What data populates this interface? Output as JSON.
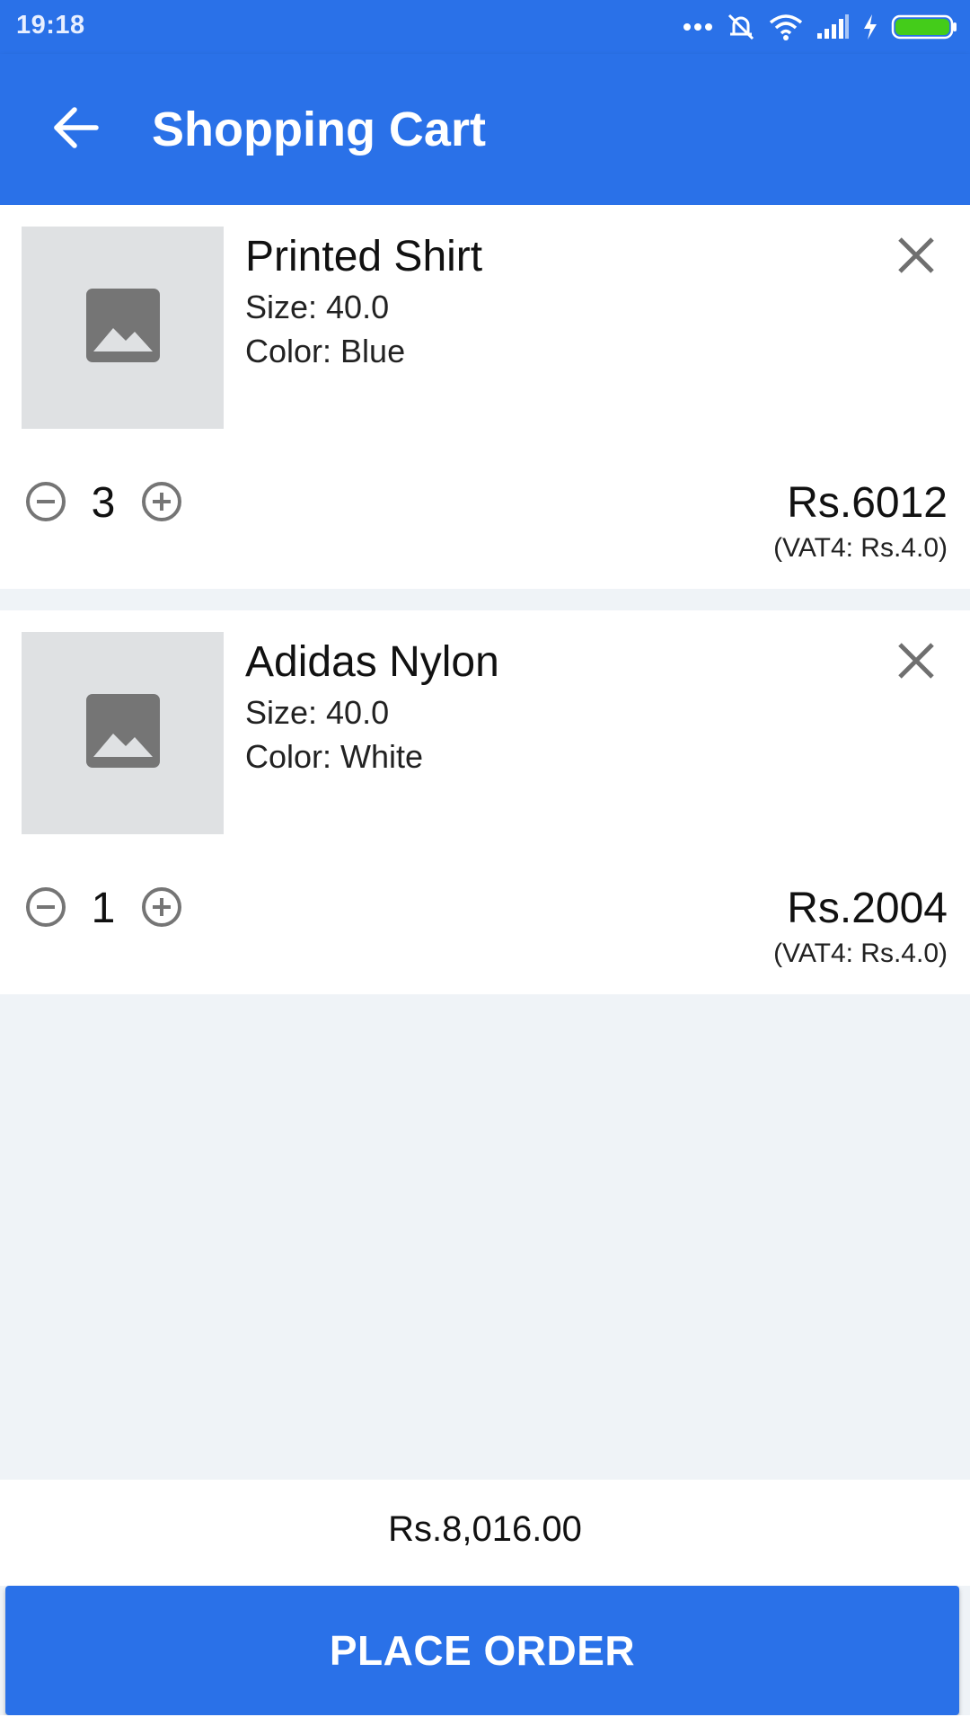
{
  "status_bar": {
    "time": "19:18",
    "icons": [
      "more-dots-icon",
      "muted-bell-icon",
      "wifi-icon",
      "signal-icon",
      "charging-bolt-icon",
      "battery-icon"
    ],
    "battery_color": "#44cc1a"
  },
  "app_bar": {
    "title": "Shopping Cart",
    "back_icon": "arrow-left-icon",
    "color": "#2a71e8"
  },
  "cart": {
    "items": [
      {
        "name": "Printed Shirt",
        "size": "Size: 40.0",
        "color": "Color: Blue",
        "quantity": "3",
        "price": "Rs.6012",
        "vat": "(VAT4: Rs.4.0)"
      },
      {
        "name": "Adidas Nylon",
        "size": "Size: 40.0",
        "color": "Color: White",
        "quantity": "1",
        "price": "Rs.2004",
        "vat": "(VAT4: Rs.4.0)"
      }
    ]
  },
  "footer": {
    "total": "Rs.8,016.00",
    "place_order_label": "PLACE ORDER"
  },
  "colors": {
    "primary": "#2a71e8",
    "background": "#eff3f7",
    "placeholder": "#dfe1e3",
    "icon_gray": "#757575"
  }
}
